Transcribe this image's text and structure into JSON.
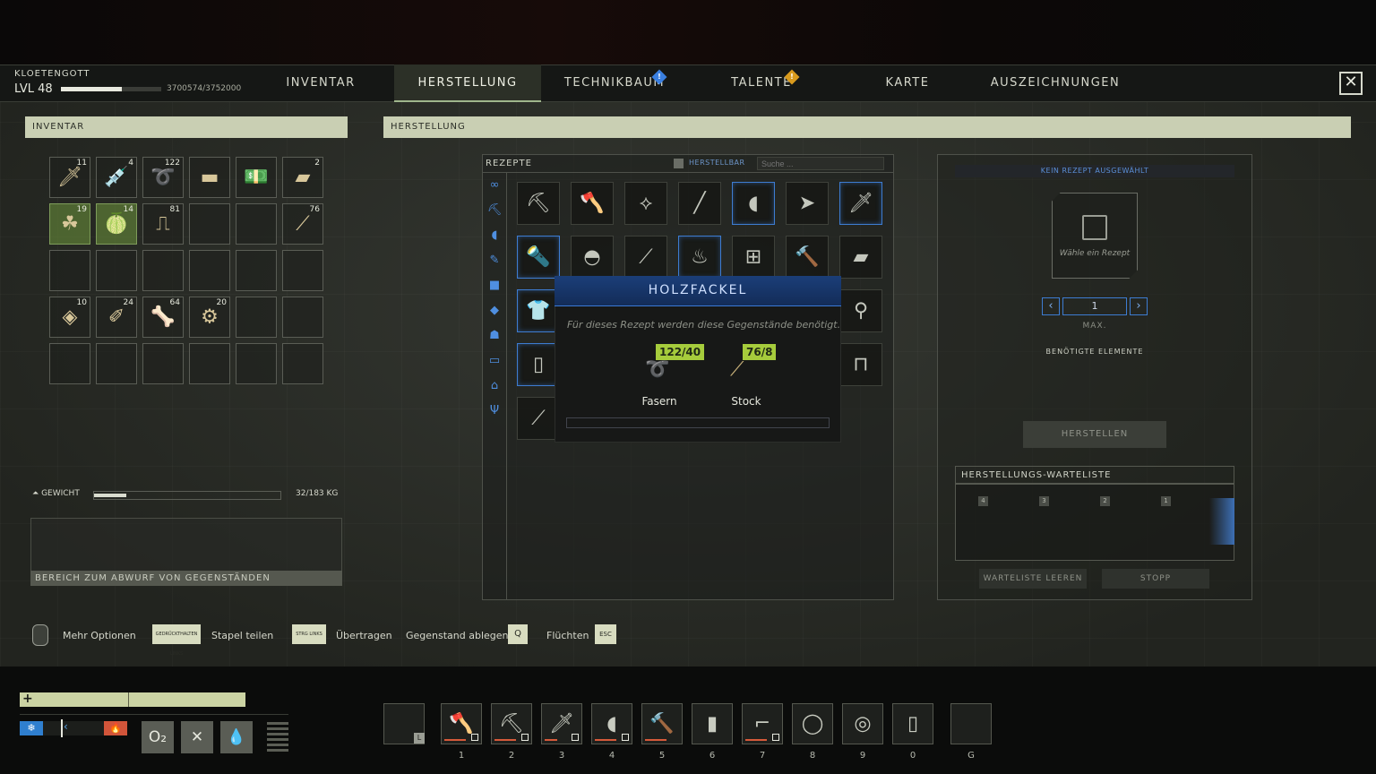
{
  "player": {
    "name": "KLOETENGOTT",
    "level": "LVL 48",
    "xp_text": "3700574/3752000",
    "xp_fraction": 0.986
  },
  "tabs": [
    {
      "label": "INVENTAR",
      "active": false,
      "alert": false
    },
    {
      "label": "HERSTELLUNG",
      "active": true,
      "alert": false
    },
    {
      "label": "TECHNIKBAUM",
      "active": false,
      "alert": true,
      "alert_color": "#3a7fe0"
    },
    {
      "label": "TALENTE",
      "active": false,
      "alert": true,
      "alert_color": "#d89a1d"
    },
    {
      "label": "KARTE",
      "active": false,
      "alert": false
    },
    {
      "label": "AUSZEICHNUNGEN",
      "active": false,
      "alert": false
    }
  ],
  "inventory": {
    "header": "INVENTAR",
    "slots": [
      {
        "icon": "knife-icon",
        "count": "11"
      },
      {
        "icon": "syringe-icon",
        "count": "4"
      },
      {
        "icon": "fiber-icon",
        "count": "122"
      },
      {
        "icon": "metal-bar-icon",
        "count": ""
      },
      {
        "icon": "cash-icon",
        "count": ""
      },
      {
        "icon": "iron-ingot-icon",
        "count": "2"
      },
      {
        "icon": "plant-icon",
        "count": "19",
        "green": true
      },
      {
        "icon": "melon-icon",
        "count": "14",
        "green": true
      },
      {
        "icon": "bandage-icon",
        "count": "81"
      },
      {
        "icon": "",
        "count": ""
      },
      {
        "icon": "",
        "count": ""
      },
      {
        "icon": "sticks-icon",
        "count": "76"
      },
      {
        "icon": "",
        "count": ""
      },
      {
        "icon": "",
        "count": ""
      },
      {
        "icon": "",
        "count": ""
      },
      {
        "icon": "",
        "count": ""
      },
      {
        "icon": "",
        "count": ""
      },
      {
        "icon": "",
        "count": ""
      },
      {
        "icon": "leather-icon",
        "count": "10"
      },
      {
        "icon": "feather-icon",
        "count": "24"
      },
      {
        "icon": "bone-icon",
        "count": "64"
      },
      {
        "icon": "scrap-icon",
        "count": "20"
      },
      {
        "icon": "",
        "count": ""
      },
      {
        "icon": "",
        "count": ""
      },
      {
        "icon": "",
        "count": ""
      },
      {
        "icon": "",
        "count": ""
      },
      {
        "icon": "",
        "count": ""
      },
      {
        "icon": "",
        "count": ""
      },
      {
        "icon": "",
        "count": ""
      },
      {
        "icon": "",
        "count": ""
      }
    ],
    "weight_label": "GEWICHT",
    "weight_text": "32/183 KG",
    "weight_fraction": 0.175,
    "drop_zone": "BEREICH ZUM ABWURF VON GEGENSTÄNDEN"
  },
  "crafting": {
    "header": "HERSTELLUNG",
    "recipes_label": "REZEPTE",
    "craftable_label": "HERSTELLBAR",
    "search_placeholder": "Suche ...",
    "categories": [
      "infinity-icon",
      "pickaxe-icon",
      "bow-icon",
      "tool-icon",
      "cube-icon",
      "shield-icon",
      "animal-icon",
      "chest-icon",
      "tent-icon",
      "cutlery-icon"
    ],
    "recipe_rows": [
      [
        "pickaxe-icon",
        "axe-icon",
        "machete-icon",
        "spear-icon",
        "bow-icon",
        "arrowhead-icon",
        "knife-icon"
      ],
      [
        "torch-icon",
        "bowl-icon",
        "stick-icon",
        "campfire-icon",
        "workbench-icon",
        "hammer-icon",
        "whetstone-icon"
      ],
      [
        "shirt-icon",
        "",
        "",
        "",
        "",
        "",
        "mace-icon"
      ],
      [
        "bandage-roll-icon",
        "",
        "",
        "",
        "",
        "",
        "rack-icon"
      ],
      [
        "knife-blade-icon",
        "",
        "",
        "",
        "",
        "",
        ""
      ]
    ],
    "selected_slots": [
      [
        0,
        4
      ],
      [
        0,
        6
      ],
      [
        1,
        0
      ],
      [
        1,
        3
      ],
      [
        2,
        0
      ],
      [
        3,
        0
      ]
    ],
    "tooltip": {
      "title": "HOLZFACKEL",
      "description": "Für dieses Rezept werden diese Gegenstände benötigt.",
      "ingredients": [
        {
          "name": "Fasern",
          "qty": "122/40",
          "icon": "fiber-icon"
        },
        {
          "name": "Stock",
          "qty": "76/8",
          "icon": "stick-icon"
        }
      ]
    },
    "detail": {
      "no_recipe": "KEIN REZEPT AUSGEWÄHLT",
      "choose_recipe": "Wähle ein Rezept",
      "quantity": "1",
      "max_label": "MAX.",
      "needed_label": "BENÖTIGTE ELEMENTE",
      "craft_button": "HERSTELLEN",
      "queue_header": "HERSTELLUNGS-WARTELISTE",
      "queue_numbers": [
        "4",
        "3",
        "2",
        "1"
      ],
      "clear_queue": "WARTELISTE LEEREN",
      "stop": "STOPP"
    }
  },
  "hints": [
    {
      "label": "Mehr Optionen"
    },
    {
      "label": "Stapel teilen",
      "key": "GEDRÜCKTHALTEN LINKS"
    },
    {
      "label": "Übertragen",
      "key": "STRG LINKS"
    },
    {
      "label": "Gegenstand ablegen",
      "key": "Q"
    },
    {
      "label": "Flüchten",
      "key": "ESC"
    }
  ],
  "hud": {
    "health_fraction": 0.47,
    "stats": [
      {
        "icon": "oxygen-icon",
        "label": "O₂"
      },
      {
        "icon": "food-icon",
        "label": "✕"
      },
      {
        "icon": "water-icon",
        "label": "💧"
      }
    ],
    "hotbar": [
      {
        "key": "L",
        "icon": ""
      },
      {
        "key": "1",
        "icon": "axe-icon"
      },
      {
        "key": "2",
        "icon": "pickaxe-icon"
      },
      {
        "key": "3",
        "icon": "knife-icon"
      },
      {
        "key": "4",
        "icon": "bow-icon"
      },
      {
        "key": "5",
        "icon": "hammer-icon"
      },
      {
        "key": "6",
        "icon": "can-icon"
      },
      {
        "key": "7",
        "icon": "pistol-icon"
      },
      {
        "key": "8",
        "icon": "rope-icon"
      },
      {
        "key": "9",
        "icon": "cable-icon"
      },
      {
        "key": "0",
        "icon": "scanner-icon"
      },
      {
        "key": "G",
        "icon": ""
      }
    ]
  },
  "colors": {
    "accent": "#3d7cd1",
    "header_bg": "#c9cfb3",
    "qty_ok": "#a6cc3c"
  }
}
